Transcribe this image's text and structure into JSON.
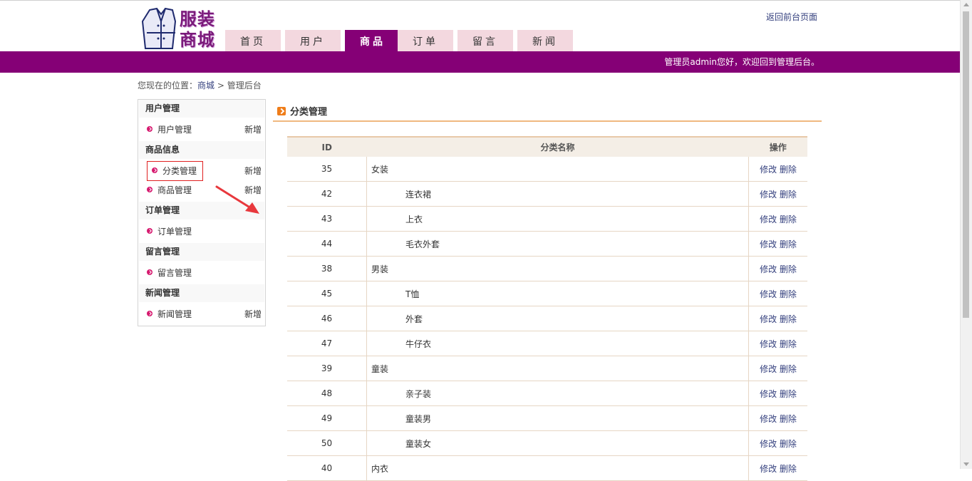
{
  "header": {
    "logo_text": "服装商城",
    "back_link": "返回前台页面",
    "welcome": "管理员admin您好，欢迎回到管理后台。",
    "nav": [
      {
        "label": "首页",
        "active": false
      },
      {
        "label": "用户",
        "active": false
      },
      {
        "label": "商品",
        "active": true
      },
      {
        "label": "订单",
        "active": false
      },
      {
        "label": "留言",
        "active": false
      },
      {
        "label": "新闻",
        "active": false
      }
    ]
  },
  "breadcrumb": {
    "prefix": "您现在的位置：",
    "home": "商城",
    "sep": ">",
    "current": "管理后台"
  },
  "sidebar": {
    "groups": [
      {
        "title": "用户管理",
        "items": [
          {
            "label": "用户管理",
            "add": "新增"
          }
        ]
      },
      {
        "title": "商品信息",
        "items": [
          {
            "label": "分类管理",
            "add": "新增",
            "highlight": true
          },
          {
            "label": "商品管理",
            "add": "新增"
          }
        ]
      },
      {
        "title": "订单管理",
        "items": [
          {
            "label": "订单管理",
            "add": ""
          }
        ]
      },
      {
        "title": "留言管理",
        "items": [
          {
            "label": "留言管理",
            "add": ""
          }
        ]
      },
      {
        "title": "新闻管理",
        "items": [
          {
            "label": "新闻管理",
            "add": "新增"
          }
        ]
      }
    ]
  },
  "main": {
    "section_title": "分类管理",
    "columns": {
      "id": "ID",
      "name": "分类名称",
      "ops": "操作"
    },
    "edit_label": "修改",
    "delete_label": "删除",
    "rows": [
      {
        "id": "35",
        "name": "女装",
        "child": false
      },
      {
        "id": "42",
        "name": "连衣裙",
        "child": true
      },
      {
        "id": "43",
        "name": "上衣",
        "child": true
      },
      {
        "id": "44",
        "name": "毛衣外套",
        "child": true
      },
      {
        "id": "38",
        "name": "男装",
        "child": false
      },
      {
        "id": "45",
        "name": "T恤",
        "child": true
      },
      {
        "id": "46",
        "name": "外套",
        "child": true
      },
      {
        "id": "47",
        "name": "牛仔衣",
        "child": true
      },
      {
        "id": "39",
        "name": "童装",
        "child": false
      },
      {
        "id": "48",
        "name": "亲子装",
        "child": true
      },
      {
        "id": "49",
        "name": "童装男",
        "child": true
      },
      {
        "id": "50",
        "name": "童装女",
        "child": true
      },
      {
        "id": "40",
        "name": "内衣",
        "child": false
      }
    ]
  },
  "colors": {
    "brand": "#850076",
    "nav_tab": "#f3d8df",
    "accent_orange": "#ef7d1a",
    "link": "#333f7d",
    "bullet": "#d6186e"
  }
}
